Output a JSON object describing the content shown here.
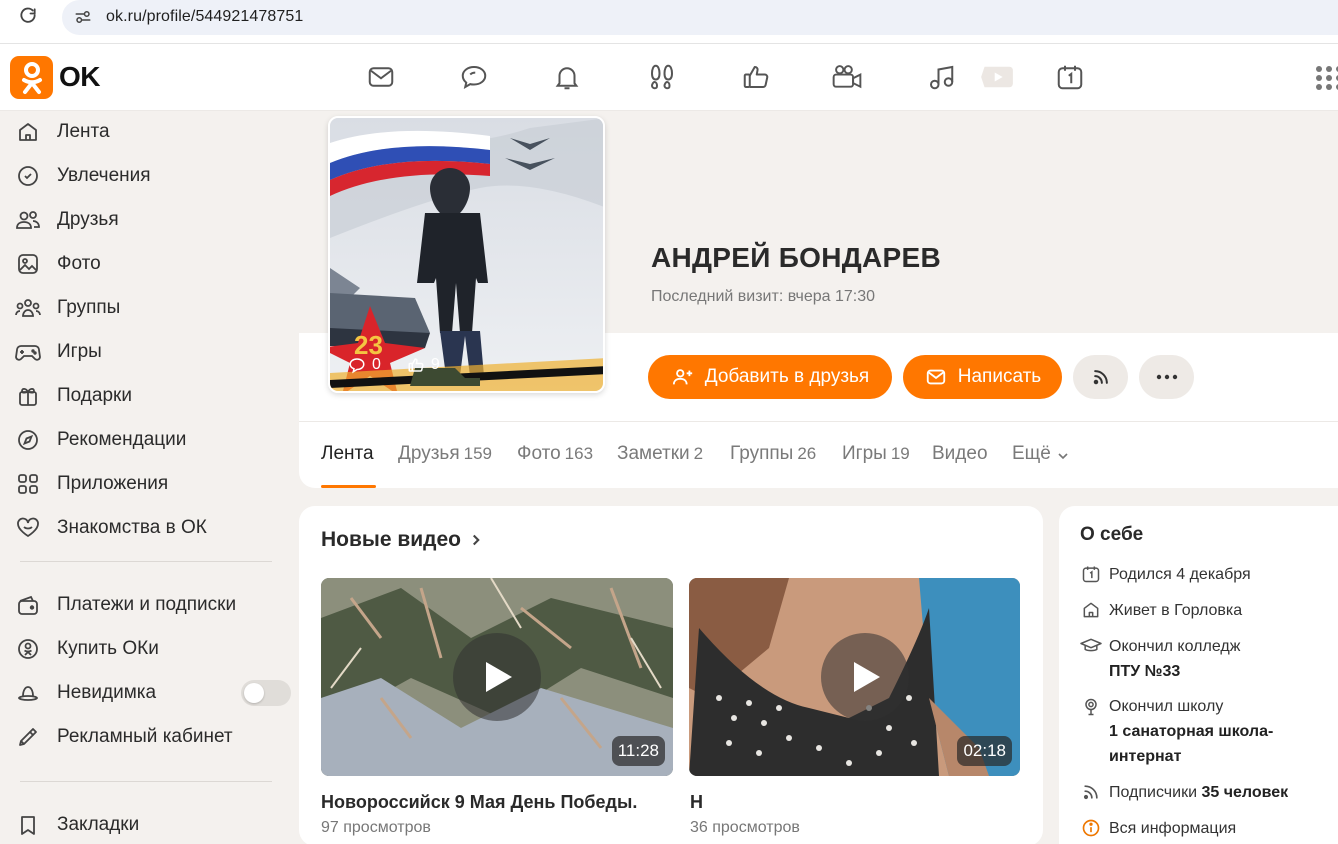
{
  "browser": {
    "url": "ok.ru/profile/544921478751"
  },
  "logo": {
    "text": "OK"
  },
  "topnav": {
    "icons": [
      "mail-icon",
      "chat-icon",
      "bell-icon",
      "guests-icon",
      "like-icon",
      "video-camera-icon",
      "music-icon",
      "play-icon",
      "calendar-icon",
      "apps-grid-icon"
    ]
  },
  "sidebar": {
    "items": [
      {
        "label": "Лента",
        "icon": "home-icon"
      },
      {
        "label": "Увлечения",
        "icon": "hobby-icon"
      },
      {
        "label": "Друзья",
        "icon": "friends-icon"
      },
      {
        "label": "Фото",
        "icon": "photo-icon"
      },
      {
        "label": "Группы",
        "icon": "groups-icon"
      },
      {
        "label": "Игры",
        "icon": "gamepad-icon"
      },
      {
        "label": "Подарки",
        "icon": "gift-icon"
      },
      {
        "label": "Рекомендации",
        "icon": "compass-icon"
      },
      {
        "label": "Приложения",
        "icon": "apps-icon"
      },
      {
        "label": "Знакомства в ОК",
        "icon": "heart-icon"
      }
    ],
    "items2": [
      {
        "label": "Платежи и подписки",
        "icon": "wallet-icon"
      },
      {
        "label": "Купить ОКи",
        "icon": "coin-icon"
      },
      {
        "label": "Невидимка",
        "icon": "hat-icon",
        "toggle": false
      },
      {
        "label": "Рекламный кабинет",
        "icon": "megaphone-icon"
      }
    ],
    "items3": [
      {
        "label": "Закладки",
        "icon": "bookmark-icon"
      }
    ]
  },
  "profile": {
    "name": "АНДРЕЙ БОНДАРЕВ",
    "last_visit": "Последний визит: вчера 17:30",
    "avatar_comments": "0",
    "avatar_likes": "9",
    "buttons": {
      "add_friend": "Добавить в друзья",
      "write": "Написать"
    }
  },
  "tabs": [
    {
      "label": "Лента",
      "count": ""
    },
    {
      "label": "Друзья",
      "count": "159"
    },
    {
      "label": "Фото",
      "count": "163"
    },
    {
      "label": "Заметки",
      "count": "2"
    },
    {
      "label": "Группы",
      "count": "26"
    },
    {
      "label": "Игры",
      "count": "19"
    },
    {
      "label": "Видео",
      "count": ""
    },
    {
      "label": "Ещё",
      "count": ""
    }
  ],
  "videos": {
    "title": "Новые видео",
    "items": [
      {
        "title": "Новороссийск 9 Мая День Победы.",
        "views": "97 просмотров",
        "duration": "11:28"
      },
      {
        "title": "Н",
        "views": "36 просмотров",
        "duration": "02:18"
      }
    ]
  },
  "about": {
    "title": "О себе",
    "born": "Родился 4 декабря",
    "lives": "Живет в Горловка",
    "college_label": "Окончил колледж",
    "college_name": "ПТУ №33",
    "school_label": "Окончил школу",
    "school_name": "1 санаторная школа-интернат",
    "subscribers_label": "Подписчики",
    "subscribers_count": "35 человек",
    "all_info": "Вся информация"
  },
  "colors": {
    "accent": "#ff7700",
    "background": "#f4f1ee"
  }
}
